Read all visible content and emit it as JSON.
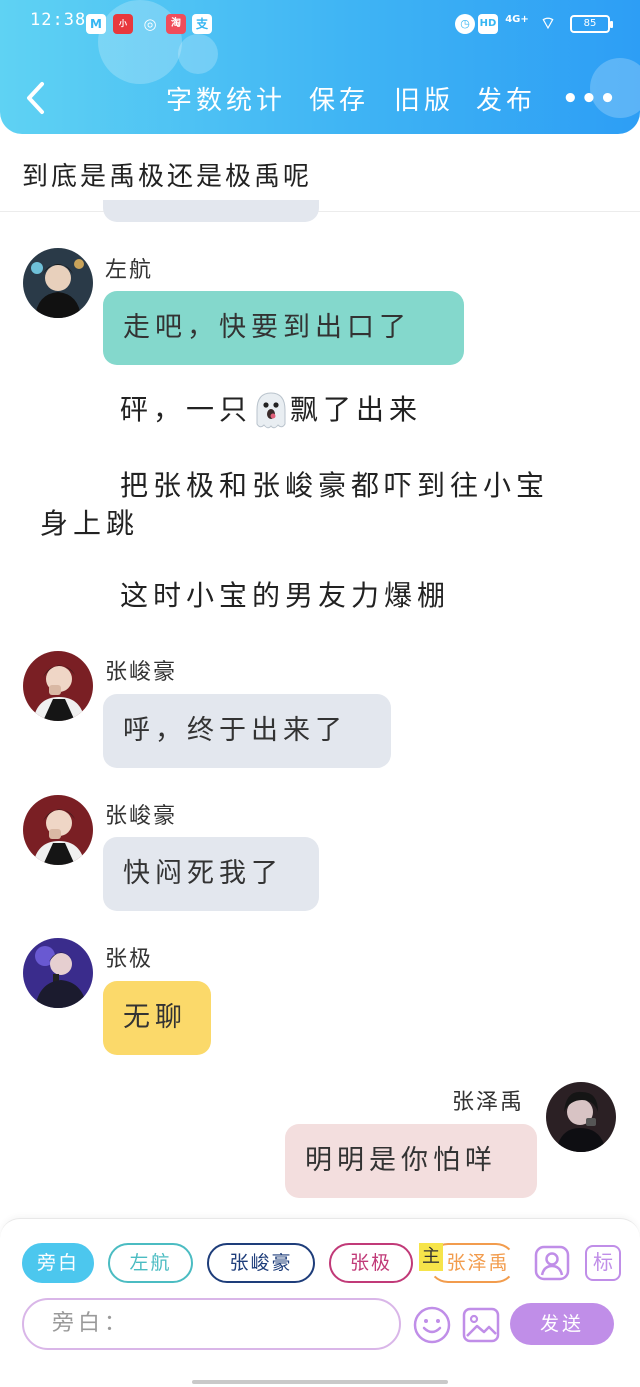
{
  "status_bar": {
    "time": "12:38",
    "battery": "85",
    "network": "4G+",
    "hd": "HD"
  },
  "nav": {
    "back_icon": "chevron-left-icon",
    "word_count": "字数统计",
    "save": "保存",
    "old_version": "旧版",
    "publish": "发布",
    "more": "•••"
  },
  "story_title": "到底是禹极还是极禹呢",
  "messages": [
    {
      "sender": "左航",
      "text": "走吧，快要到出口了",
      "bubble_color": "#84d8cc"
    },
    {
      "sender": "张峻豪",
      "text": "呼，终于出来了",
      "bubble_color": "#e3e7ee"
    },
    {
      "sender": "张峻豪",
      "text": "快闷死我了",
      "bubble_color": "#e3e7ee"
    },
    {
      "sender": "张极",
      "text": "无聊",
      "bubble_color": "#fbd96a"
    },
    {
      "sender": "张泽禹",
      "text": "明明是你怕咩",
      "bubble_color": "#f3dede"
    }
  ],
  "narration": {
    "line1_a": "砰，一只",
    "line1_b": "飘了出来",
    "line2_a": "把张极和张峻豪都吓到往小宝",
    "line2_b": "身上跳",
    "line3": "这时小宝的男友力爆棚"
  },
  "characters": {
    "narrator": "旁白",
    "c1": "左航",
    "c2": "张峻豪",
    "c3": "张极",
    "main_tag": "主",
    "c4": "张泽禹"
  },
  "character_colors": {
    "narrator": "#4cc7ee",
    "c1": "#4bbcc2",
    "c2": "#1e3d7a",
    "c3": "#c13a78",
    "c4": "#f29c4d"
  },
  "tools": {
    "add_role": "user-add-icon",
    "mark_label": "标"
  },
  "input": {
    "placeholder": "旁白："
  },
  "send_label": "发送",
  "accent_color": "#c08ee8"
}
